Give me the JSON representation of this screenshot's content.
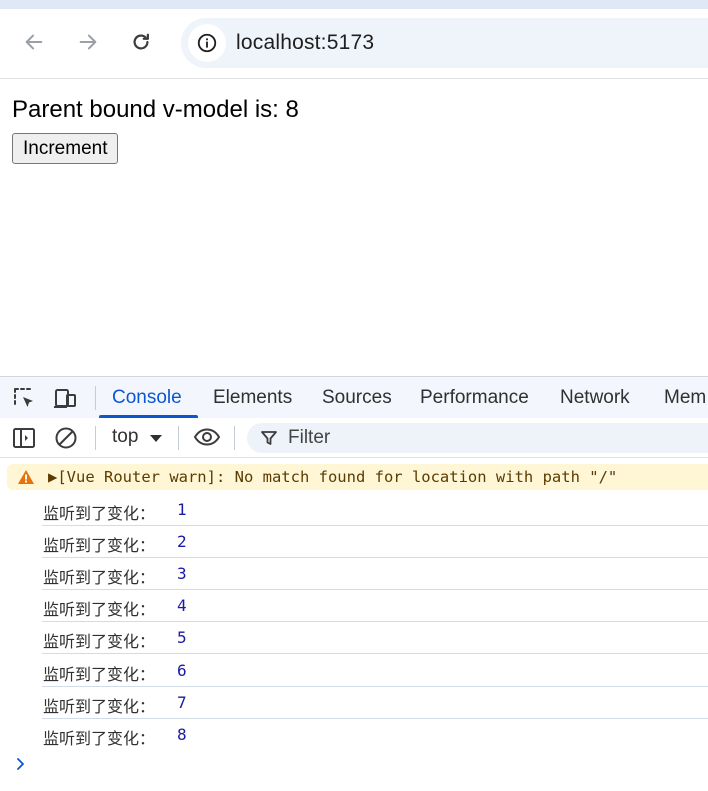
{
  "browser": {
    "url": "localhost:5173",
    "back_icon": "arrow-left-icon",
    "forward_icon": "arrow-right-icon",
    "reload_icon": "reload-icon",
    "site_info_icon": "info-icon"
  },
  "page": {
    "text": "Parent bound v-model is: 8",
    "button_label": "Increment"
  },
  "devtools": {
    "tabs": [
      "Console",
      "Elements",
      "Sources",
      "Performance",
      "Network",
      "Mem"
    ],
    "active_tab": "Console",
    "context": "top",
    "filter_placeholder": "Filter",
    "accent_color": "#0b57d0"
  },
  "console": {
    "warning": "▶[Vue Router warn]: No match found for location with path \"/\"",
    "logs": [
      {
        "label": "监听到了变化：",
        "value": "1"
      },
      {
        "label": "监听到了变化：",
        "value": "2"
      },
      {
        "label": "监听到了变化：",
        "value": "3"
      },
      {
        "label": "监听到了变化：",
        "value": "4"
      },
      {
        "label": "监听到了变化：",
        "value": "5"
      },
      {
        "label": "监听到了变化：",
        "value": "6"
      },
      {
        "label": "监听到了变化：",
        "value": "7"
      },
      {
        "label": "监听到了变化：",
        "value": "8"
      }
    ]
  }
}
